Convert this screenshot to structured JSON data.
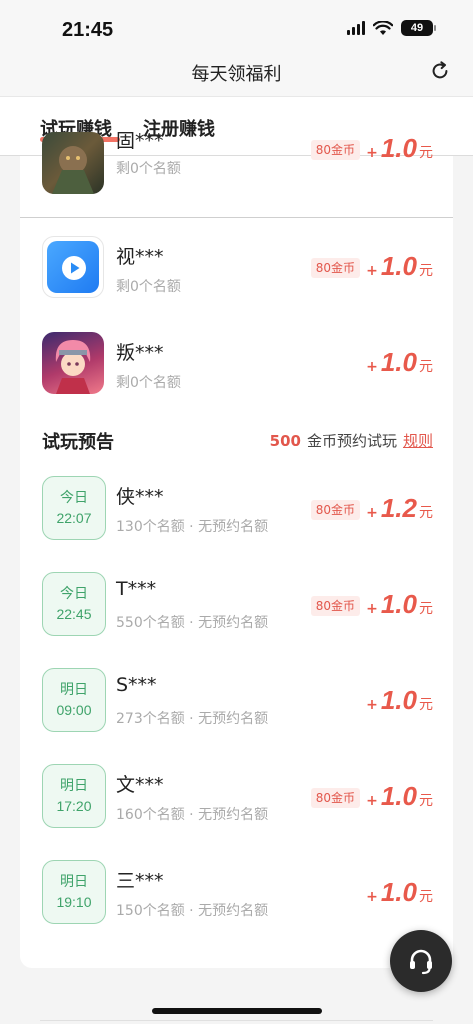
{
  "status": {
    "time": "21:45",
    "battery": "49"
  },
  "header": {
    "title": "每天领福利"
  },
  "tabs": [
    {
      "label": "试玩赚钱",
      "active": true
    },
    {
      "label": "注册赚钱",
      "active": false
    }
  ],
  "apps": [
    {
      "name": "固***",
      "quota": "剩0个名额",
      "badge": "80金币",
      "plus": "+",
      "amount": "1.0",
      "unit": "元"
    },
    {
      "name": "视***",
      "quota": "剩0个名额",
      "badge": "80金币",
      "plus": "+",
      "amount": "1.0",
      "unit": "元"
    },
    {
      "name": "叛***",
      "quota": "剩0个名额",
      "badge": "",
      "plus": "+",
      "amount": "1.0",
      "unit": "元"
    }
  ],
  "preview": {
    "title": "试玩预告",
    "coins": "500",
    "coins_label": "金币预约试玩",
    "rule_link": "规则",
    "items": [
      {
        "day": "今日",
        "time": "22:07",
        "name": "侠***",
        "quota": "130个名额 · 无预约名额",
        "badge": "80金币",
        "plus": "+",
        "amount": "1.2",
        "unit": "元"
      },
      {
        "day": "今日",
        "time": "22:45",
        "name": "T***",
        "quota": "550个名额 · 无预约名额",
        "badge": "80金币",
        "plus": "+",
        "amount": "1.0",
        "unit": "元"
      },
      {
        "day": "明日",
        "time": "09:00",
        "name": "S***",
        "quota": "273个名额 · 无预约名额",
        "badge": "",
        "plus": "+",
        "amount": "1.0",
        "unit": "元"
      },
      {
        "day": "明日",
        "time": "17:20",
        "name": "文***",
        "quota": "160个名额 · 无预约名额",
        "badge": "80金币",
        "plus": "+",
        "amount": "1.0",
        "unit": "元"
      },
      {
        "day": "明日",
        "time": "19:10",
        "name": "三***",
        "quota": "150个名额 · 无预约名额",
        "badge": "",
        "plus": "+",
        "amount": "1.0",
        "unit": "元"
      }
    ]
  },
  "colors": {
    "accent": "#e8594b",
    "green": "#3fa36a",
    "badge_bg": "#fdecea"
  },
  "icons": [
    "refresh-icon",
    "play-icon",
    "headset-icon"
  ]
}
